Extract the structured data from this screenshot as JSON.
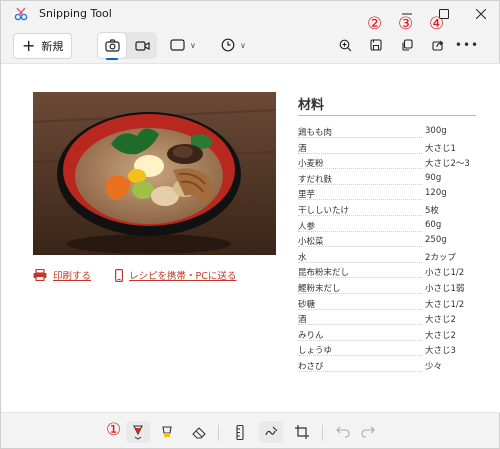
{
  "window": {
    "title": "Snipping Tool",
    "minimize_icon": "minimize-icon",
    "maximize_icon": "maximize-icon",
    "close_icon": "close-icon"
  },
  "toolbar": {
    "new_label": "新規",
    "mode_screenshot_icon": "camera-icon",
    "mode_video_icon": "video-camera-icon",
    "shape_icon": "rectangle-snip-icon",
    "timer_icon": "clock-icon",
    "zoom_icon": "zoom-in-icon",
    "save_icon": "save-icon",
    "copy_icon": "copy-icon",
    "share_icon": "share-icon",
    "more_icon": "more-icon"
  },
  "annotations": {
    "one": "①",
    "two": "②",
    "three": "③",
    "four": "④"
  },
  "recipe": {
    "title": "材料",
    "print_link": "印刷する",
    "mobile_link": "レシピを携帯・PCに送る",
    "ingredients": [
      {
        "name": "鶏もも肉",
        "amount": "300g"
      },
      {
        "name": "酒",
        "amount": "大さじ1"
      },
      {
        "name": "小麦粉",
        "amount": "大さじ2〜3"
      },
      {
        "name": "すだれ麩",
        "amount": "90g"
      },
      {
        "name": "里芋",
        "amount": "120g"
      },
      {
        "name": "干ししいたけ",
        "amount": "5枚"
      },
      {
        "name": "人参",
        "amount": "60g"
      },
      {
        "name": "小松菜",
        "amount": "250g"
      },
      {
        "name": "水",
        "amount": "2カップ"
      },
      {
        "name": "昆布粉末だし",
        "amount": "小さじ1/2"
      },
      {
        "name": "鰹粉末だし",
        "amount": "小さじ1弱"
      },
      {
        "name": "砂糖",
        "amount": "大さじ1/2"
      },
      {
        "name": "酒",
        "amount": "大さじ2"
      },
      {
        "name": "みりん",
        "amount": "大さじ2"
      },
      {
        "name": "しょうゆ",
        "amount": "大さじ3"
      },
      {
        "name": "わさび",
        "amount": "少々"
      }
    ]
  },
  "bottom_tools": {
    "ballpoint_pen": "ballpoint-pen-icon",
    "highlighter": "highlighter-icon",
    "eraser": "eraser-icon",
    "ruler": "ruler-icon",
    "touch_writing": "touch-writing-icon",
    "crop": "crop-icon",
    "undo": "undo-icon",
    "redo": "redo-icon"
  },
  "colors": {
    "accent": "#0067c0",
    "link": "#c0392b",
    "annotation": "#e01c1c",
    "pen_red": "#d62828",
    "highlighter_yellow": "#f5c400"
  }
}
